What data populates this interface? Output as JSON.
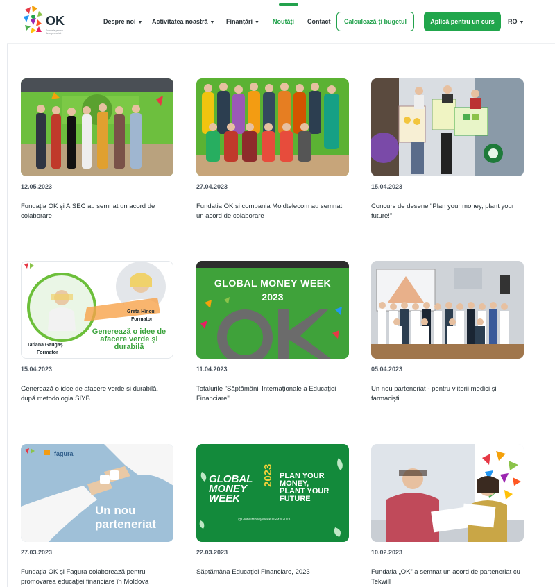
{
  "header": {
    "logo_text": "OK",
    "logo_subtitle": "Fundația pentru Antreprenoriat",
    "nav": [
      {
        "label": "Despre noi",
        "has_dropdown": true
      },
      {
        "label": "Activitatea noastră",
        "has_dropdown": true
      },
      {
        "label": "Finanțări",
        "has_dropdown": true
      },
      {
        "label": "Noutăți",
        "has_dropdown": false,
        "active": true
      },
      {
        "label": "Contact",
        "has_dropdown": false
      }
    ],
    "budget_button": "Calculează-ți bugetul",
    "apply_button": "Aplică pentru un curs",
    "language": "RO"
  },
  "colors": {
    "brand_green": "#23a24d",
    "gmw_green": "#138a3b",
    "nav_text": "#2b3338"
  },
  "news": [
    {
      "date": "12.05.2023",
      "title": "Fundația OK și AISEC au semnat un acord de colaborare"
    },
    {
      "date": "27.04.2023",
      "title": "Fundația OK și compania Moldtelecom au semnat un acord de colaborare"
    },
    {
      "date": "15.04.2023",
      "title": "Concurs de desene \"Plan your money, plant your future!\""
    },
    {
      "date": "15.04.2023",
      "title": "Generează o idee de afacere verde și durabilă, după metodologia SIYB"
    },
    {
      "date": "11.04.2023",
      "title": "Totalurile \"Săptămânii Internaționale a Educației Financiare\""
    },
    {
      "date": "05.04.2023",
      "title": "Un nou parteneriat - pentru viitorii medici și farmaciști"
    },
    {
      "date": "27.03.2023",
      "title": "Fundația OK și Fagura colaborează pentru promovarea educației financiare în Moldova"
    },
    {
      "date": "22.03.2023",
      "title": "Săptămâna Educației Financiare, 2023"
    },
    {
      "date": "10.02.2023",
      "title": "Fundația „OK” a semnat un acord de parteneriat cu Tekwill"
    }
  ],
  "thumb_text": {
    "siyb_name1": "Greta Hîncu",
    "siyb_role1": "Formator",
    "siyb_name2": "Tatiana Gaugaș",
    "siyb_role2": "Formator",
    "siyb_slogan": "Generează o idee de afacere verde și durabilă",
    "gmw_title": "GLOBAL MONEY WEEK",
    "gmw_year": "2023",
    "fagura_brand": "fagura",
    "fagura_slogan1": "Un nou",
    "fagura_slogan2": "parteneriat",
    "gmw2_line1": "GLOBAL",
    "gmw2_line2": "MONEY",
    "gmw2_line3": "WEEK",
    "gmw2_year": "2023",
    "gmw2_tag1": "PLAN YOUR",
    "gmw2_tag2": "MONEY,",
    "gmw2_tag3": "PLANT YOUR",
    "gmw2_tag4": "FUTURE",
    "gmw2_hashtags": "@GlobalMoneyWeek #GMW2023"
  }
}
